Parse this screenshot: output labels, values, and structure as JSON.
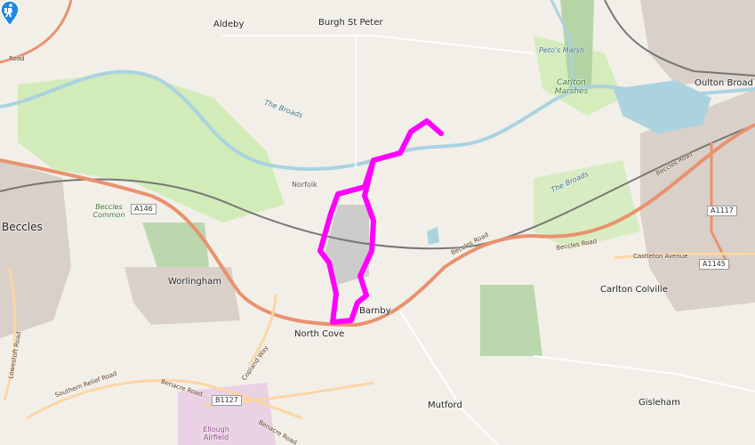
{
  "map": {
    "places": {
      "aldeby": "Aldeby",
      "burgh_st_peter": "Burgh St Peter",
      "oulton_broad": "Oulton Broad",
      "beccles": "Beccles",
      "worlingham": "Worlingham",
      "north_cove": "North Cove",
      "barnby": "Barnby",
      "carlton_colville": "Carlton Colville",
      "mutford": "Mutford",
      "gisleham": "Gisleham",
      "ellough_airfield": "Ellough Airfield",
      "norfolk": "Norfolk"
    },
    "water_labels": {
      "the_broads_1": "The Broads",
      "the_broads_2": "The Broads",
      "petos_marsh": "Peto's Marsh"
    },
    "green_labels": {
      "beccles_common": "Beccles Common",
      "carlton_marshes": "Carlton Marshes"
    },
    "road_labels": {
      "a146": "A146",
      "a1117": "A1117",
      "a1145": "A1145",
      "b1127": "B1127",
      "beccles_road_top": "Beccles Road",
      "beccles_road_east": "Beccles Road",
      "beccles_road_mid": "Beccles Road",
      "castleton_avenue": "Castleton Avenue",
      "copland_way": "Copland Way",
      "southern_relief_road": "Southern Relief Road",
      "benacre_road_1": "Benacre Road",
      "benacre_road_2": "Benacre Road",
      "lowestoft_road": "Lowestoft Road",
      "road_top_left": "Road"
    },
    "route_color": "#ff00ff",
    "marker_icon": "hiker-icon"
  }
}
